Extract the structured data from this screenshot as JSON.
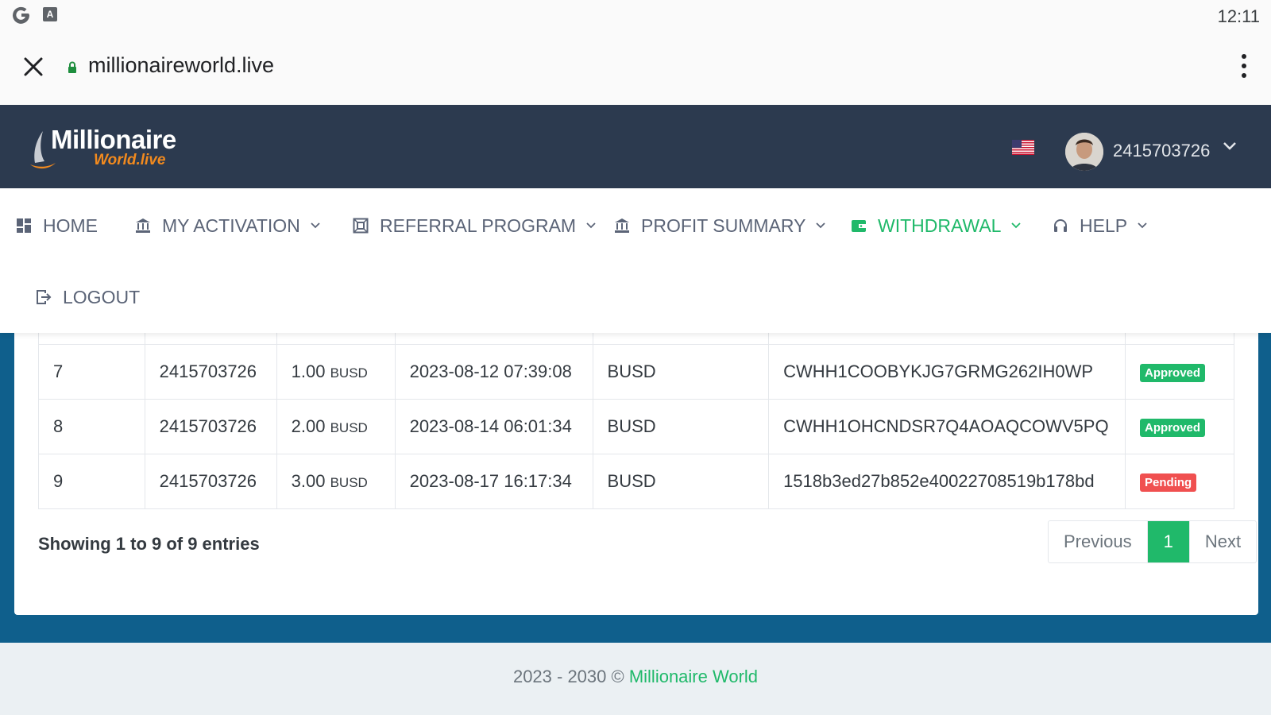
{
  "status_bar": {
    "time": "12:11",
    "icons": [
      "google-g-icon",
      "accessibility-a-icon"
    ],
    "a_glyph": "A"
  },
  "browser": {
    "url": "millionaireworld.live",
    "icons": [
      "close-icon",
      "lock-icon",
      "more-vert-icon"
    ]
  },
  "header": {
    "logo_title": "Millionaire",
    "logo_subtitle": "World.live",
    "user_id": "2415703726",
    "language_flag": "us-flag-icon"
  },
  "nav": {
    "items": [
      {
        "label": "HOME",
        "icon": "dashboard-icon",
        "dropdown": false
      },
      {
        "label": "MY ACTIVATION",
        "icon": "bank-icon",
        "dropdown": true
      },
      {
        "label": "REFERRAL PROGRAM",
        "icon": "network-icon",
        "dropdown": true
      },
      {
        "label": "PROFIT SUMMARY",
        "icon": "bank-icon",
        "dropdown": true
      },
      {
        "label": "WITHDRAWAL",
        "icon": "wallet-icon",
        "dropdown": true,
        "active": true
      },
      {
        "label": "HELP",
        "icon": "headphones-icon",
        "dropdown": true
      },
      {
        "label": "LOGOUT",
        "icon": "logout-icon",
        "dropdown": false
      }
    ]
  },
  "table": {
    "rows": [
      {
        "num": "7",
        "user_id": "2415703726",
        "amount": "1.00",
        "unit": "BUSD",
        "datetime": "2023-08-12 07:39:08",
        "currency": "BUSD",
        "txn": "CWHH1COOBYKJG7GRMG262IH0WP",
        "status": "Approved"
      },
      {
        "num": "8",
        "user_id": "2415703726",
        "amount": "2.00",
        "unit": "BUSD",
        "datetime": "2023-08-14 06:01:34",
        "currency": "BUSD",
        "txn": "CWHH1OHCNDSR7Q4AOAQCOWV5PQ",
        "status": "Approved"
      },
      {
        "num": "9",
        "user_id": "2415703726",
        "amount": "3.00",
        "unit": "BUSD",
        "datetime": "2023-08-17 16:17:34",
        "currency": "BUSD",
        "txn": "1518b3ed27b852e40022708519b178bd",
        "status": "Pending"
      }
    ],
    "showing": "Showing 1 to 9 of 9 entries"
  },
  "pagination": {
    "previous": "Previous",
    "page": "1",
    "next": "Next"
  },
  "footer": {
    "text": "2023 - 2030 © ",
    "link": "Millionaire World"
  },
  "colors": {
    "accent": "#20b96a",
    "header_bg": "#2c3a4f",
    "band_bg": "#0f5f8c",
    "pending": "#f05050"
  }
}
